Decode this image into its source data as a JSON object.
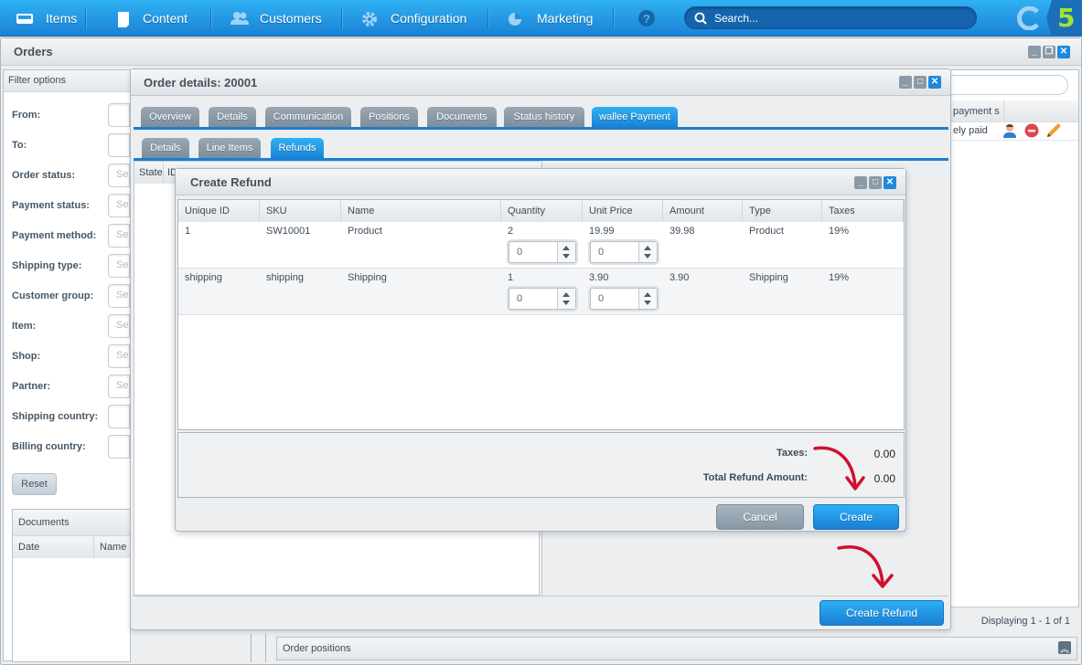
{
  "topbar": {
    "items": [
      {
        "label": "Items",
        "icon": "inbox-icon"
      },
      {
        "label": "Content",
        "icon": "document-icon"
      },
      {
        "label": "Customers",
        "icon": "users-icon"
      },
      {
        "label": "Configuration",
        "icon": "gear-icon"
      },
      {
        "label": "Marketing",
        "icon": "pie-chart-icon"
      }
    ],
    "help_icon": "?",
    "search_placeholder": "Search...",
    "logo_text": "5"
  },
  "orders_window": {
    "title": "Orders",
    "filter": {
      "title": "Filter options",
      "fields": [
        {
          "label": "From:",
          "placeholder": ""
        },
        {
          "label": "To:",
          "placeholder": ""
        },
        {
          "label": "Order status:",
          "placeholder": "Se"
        },
        {
          "label": "Payment status:",
          "placeholder": "Se"
        },
        {
          "label": "Payment method:",
          "placeholder": "Se"
        },
        {
          "label": "Shipping type:",
          "placeholder": "Se"
        },
        {
          "label": "Customer group:",
          "placeholder": "Se"
        },
        {
          "label": "Item:",
          "placeholder": "Se"
        },
        {
          "label": "Shop:",
          "placeholder": "Se"
        },
        {
          "label": "Partner:",
          "placeholder": "Se"
        },
        {
          "label": "Shipping country:",
          "placeholder": ""
        },
        {
          "label": "Billing country:",
          "placeholder": ""
        }
      ],
      "reset_label": "Reset"
    },
    "documents": {
      "title": "Documents",
      "columns": [
        "Date",
        "Name"
      ]
    },
    "list": {
      "column_partial": "payment s",
      "row_partial": "ely paid",
      "paging": "Displaying 1 - 1 of 1"
    },
    "order_positions_label": "Order positions"
  },
  "order_details": {
    "title": "Order details: 20001",
    "tabs": [
      "Overview",
      "Details",
      "Communication",
      "Positions",
      "Documents",
      "Status history",
      "wallee Payment"
    ],
    "active_tab": "wallee Payment",
    "subtabs": [
      "Details",
      "Line Items",
      "Refunds"
    ],
    "active_subtab": "Refunds",
    "refund_columns_partial": [
      "State",
      "ID"
    ],
    "create_refund_label": "Create Refund"
  },
  "create_refund": {
    "title": "Create Refund",
    "columns": [
      "Unique ID",
      "SKU",
      "Name",
      "Quantity",
      "Unit Price",
      "Amount",
      "Type",
      "Taxes"
    ],
    "rows": [
      {
        "unique_id": "1",
        "sku": "SW10001",
        "name": "Product",
        "quantity": "2",
        "unit_price": "19.99",
        "amount": "39.98",
        "type": "Product",
        "taxes": "19%",
        "refund_quantity": "0",
        "refund_unit_price": "0"
      },
      {
        "unique_id": "shipping",
        "sku": "shipping",
        "name": "Shipping",
        "quantity": "1",
        "unit_price": "3.90",
        "amount": "3.90",
        "type": "Shipping",
        "taxes": "19%",
        "refund_quantity": "0",
        "refund_unit_price": "0"
      }
    ],
    "taxes_label": "Taxes:",
    "taxes_value": "0.00",
    "total_label": "Total Refund Amount:",
    "total_value": "0.00",
    "cancel_label": "Cancel",
    "create_label": "Create"
  },
  "colors": {
    "accent": "#1b82d6",
    "annotation_arrow": "#d0102e"
  }
}
